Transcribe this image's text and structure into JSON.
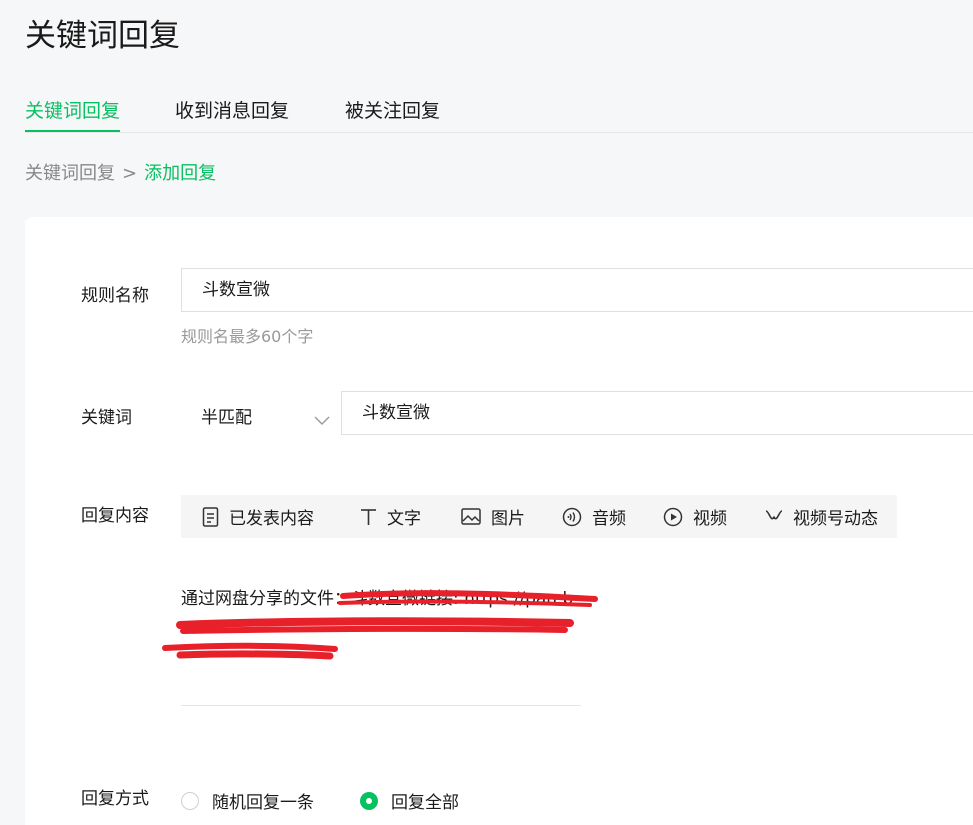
{
  "page": {
    "title": "关键词回复"
  },
  "tabs": [
    {
      "label": "关键词回复",
      "active": true
    },
    {
      "label": "收到消息回复",
      "active": false
    },
    {
      "label": "被关注回复",
      "active": false
    }
  ],
  "breadcrumb": {
    "parent": "关键词回复",
    "separator": ">",
    "current": "添加回复"
  },
  "form": {
    "rule_name": {
      "label": "规则名称",
      "value": "斗数宣微",
      "hint": "规则名最多60个字"
    },
    "keyword": {
      "label": "关键词",
      "match_mode": "半匹配",
      "value": "斗数宣微"
    },
    "reply_content": {
      "label": "回复内容",
      "tools": [
        {
          "label": "已发表内容",
          "icon": "document-icon"
        },
        {
          "label": "文字",
          "icon": "text-icon"
        },
        {
          "label": "图片",
          "icon": "image-icon"
        },
        {
          "label": "音频",
          "icon": "audio-icon"
        },
        {
          "label": "视频",
          "icon": "video-icon"
        },
        {
          "label": "视频号动态",
          "icon": "channels-icon"
        }
      ],
      "text": "通过网盘分享的文件：斗数宣微链接: https://pan.b"
    },
    "reply_mode": {
      "label": "回复方式",
      "options": [
        {
          "label": "随机回复一条",
          "checked": false
        },
        {
          "label": "回复全部",
          "checked": true
        }
      ]
    }
  },
  "colors": {
    "accent": "#07c160",
    "redaction": "#e8202a"
  }
}
